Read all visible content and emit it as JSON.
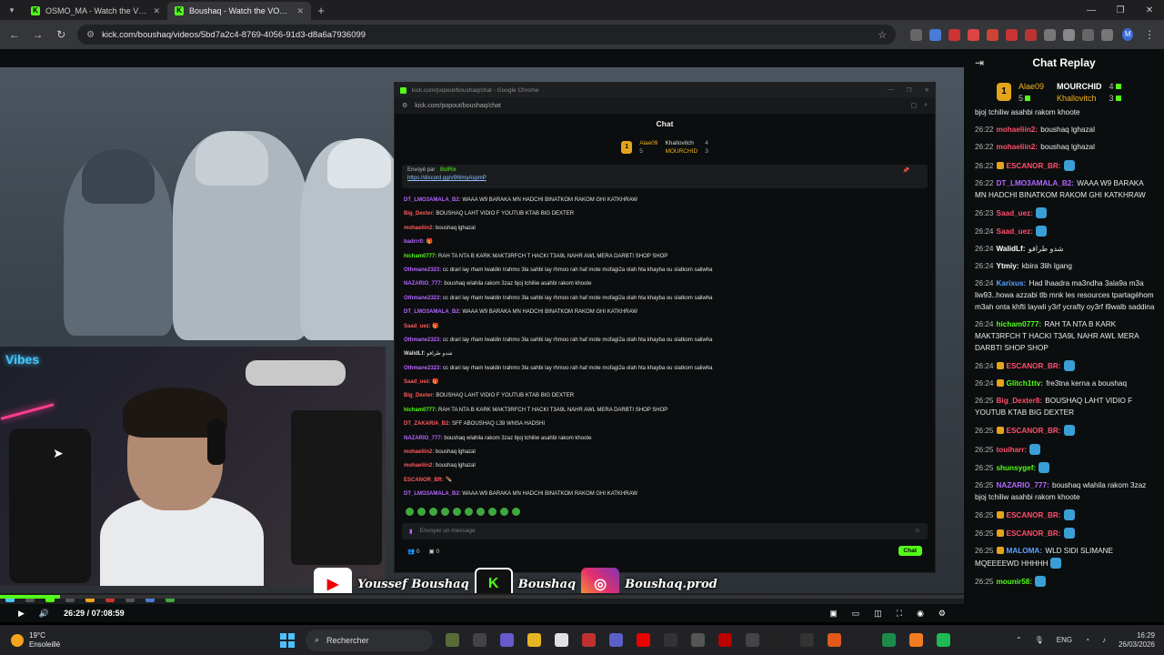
{
  "browser": {
    "tabs": [
      {
        "title": "OSMO_MA - Watch the VOD on",
        "active": false
      },
      {
        "title": "Boushaq - Watch the VOD on",
        "active": true
      }
    ],
    "url": "kick.com/boushaq/videos/5bd7a2c4-8769-4056-91d3-d8a6a7936099",
    "profile_initial": "M"
  },
  "popout": {
    "window_title": "kick.com/popout/boushaq/chat - Google Chrome",
    "url": "kick.com/popout/boushaq/chat",
    "header": "Chat",
    "gifters": {
      "first": "Alae09",
      "first_count": "5",
      "second": "Khallovitch",
      "second_count": "4",
      "third": "MOURCHID",
      "third_count": "3"
    },
    "pinned_sender": "Envoyé par",
    "pinned_sender_name": "BotRix",
    "pinned_link": "https://discord.gg/v9WmyAspmP",
    "messages": [
      {
        "user": "DT_LMO3AMALA_B2:",
        "color": "#b566ff",
        "text": " WAAA W9 BARAKA MN HADCHI BINATKOM RAKOM GHI KATKHRAW"
      },
      {
        "user": "Big_Dexter:",
        "color": "#ff5a5a",
        "text": " BOUSHAQ LAHT VIDIO F YOUTUB KTAB BIG DEXTER"
      },
      {
        "user": "mohaeliin2:",
        "color": "#ff5a5a",
        "text": " boushaq lghazal"
      },
      {
        "user": "badrrr0:",
        "color": "#b566ff",
        "text": " 🎁"
      },
      {
        "user": "hicham0777:",
        "color": "#53fc18",
        "text": " RAH TA NTA B KARK MAKT3RFCH T HACKI T3A9L NAHR AWL MERA DARBTI SHOP SHOP"
      },
      {
        "user": "Othmane2323:",
        "color": "#b566ff",
        "text": " cc drari lay rham lwaldin trahmo 3la sahbi lay rhmoo rah haf mote mofagi2a olah hta khayba ou slatkom saliwha"
      },
      {
        "user": "NAZARIO_777:",
        "color": "#b566ff",
        "text": " boushaq wlahila rakom 3zaz bjoj tchiliw asahbi rakom khoote"
      },
      {
        "user": "Othmane2323:",
        "color": "#b566ff",
        "text": " cc drari lay rham lwaldin trahmo 3la sahbi lay rhmoo rah haf mote mofagi2a olah hta khayba ou slatkom saliwha"
      },
      {
        "user": "DT_LMO3AMALA_B2:",
        "color": "#b566ff",
        "text": " WAAA W9 BARAKA MN HADCHI BINATKOM RAKOM GHI KATKHRAW"
      },
      {
        "user": "Saad_uez:",
        "color": "#ff5a5a",
        "text": " 🎁"
      },
      {
        "user": "Othmane2323:",
        "color": "#b566ff",
        "text": " cc drari lay rham lwaldin trahmo 3la sahbi lay rhmoo rah haf mote mofagi2a olah hta khayba ou slatkom saliwha"
      },
      {
        "user": "WalidLf:",
        "color": "#dddddd",
        "text": " شدو طرافو"
      },
      {
        "user": "Othmane2323:",
        "color": "#b566ff",
        "text": " cc drari lay rham lwaldin trahmo 3la sahbi lay rhmoo rah haf mote mofagi2a olah hta khayba ou slatkom saliwha"
      },
      {
        "user": "Saad_uez:",
        "color": "#ff5a5a",
        "text": " 🎁"
      },
      {
        "user": "Big_Dexter:",
        "color": "#ff5a5a",
        "text": " BOUSHAQ LAHT VIDIO F YOUTUB KTAB BIG DEXTER"
      },
      {
        "user": "hicham0777:",
        "color": "#53fc18",
        "text": " RAH TA NTA B KARK MAKT3RFCH T HACKI T3A9L NAHR AWL MERA DARBTI SHOP SHOP"
      },
      {
        "user": "DT_ZAKARIA_B2:",
        "color": "#ff5a5a",
        "text": " SFF ABOUSHAQ L39 WNSA HADSHI"
      },
      {
        "user": "NAZARIO_777:",
        "color": "#b566ff",
        "text": " boushaq wlahila rakom 3zaz bjoj tchiliw asahbi rakom khoote"
      },
      {
        "user": "mohaeliin2:",
        "color": "#ff5a5a",
        "text": " boushaq lghazal"
      },
      {
        "user": "mohaeliin2:",
        "color": "#ff5a5a",
        "text": " boushaq lghazal"
      },
      {
        "user": "ESCANOR_BR:",
        "color": "#ff5a5a",
        "text": " 🪶"
      },
      {
        "user": "DT_LMO3AMALA_B2:",
        "color": "#b566ff",
        "text": " WAAA W9 BARAKA MN HADCHI BINATKOM RAKOM GHI KATKHRAW"
      }
    ],
    "input_placeholder": "Envoyer un message",
    "bottom_count_a": "0",
    "bottom_count_b": "0",
    "chat_button": "Chat"
  },
  "socials": {
    "youtube": "Youssef Boushaq",
    "kick": "Boushaq",
    "instagram": "Boushaq.prod"
  },
  "player": {
    "time": "26:29 / 07:08:59",
    "progress": 0.062
  },
  "sidebar": {
    "title": "Chat Replay",
    "gifters": {
      "first": "Alae09",
      "first_count": "5",
      "second": "MOURCHID",
      "second_count": "4",
      "third": "Khallovitch",
      "third_count": "3"
    },
    "messages": [
      {
        "time": "",
        "user": "",
        "color": "#eaeaea",
        "text": "bjoj tchiliw asahbi rakom khoote",
        "badge": false,
        "emote": false
      },
      {
        "time": "26:22",
        "user": "mohaeliin2:",
        "color": "#ff4f6d",
        "text": " boushaq lghazal",
        "badge": false,
        "emote": false
      },
      {
        "time": "26:22",
        "user": "mohaeliin2:",
        "color": "#ff4f6d",
        "text": " boushaq lghazal",
        "badge": false,
        "emote": false
      },
      {
        "time": "26:22",
        "user": "ESCANOR_BR:",
        "color": "#ff4f6d",
        "text": "",
        "badge": true,
        "emote": true
      },
      {
        "time": "26:22",
        "user": "DT_LMO3AMALA_B2:",
        "color": "#b566ff",
        "text": " WAAA W9 BARAKA MN HADCHI BINATKOM RAKOM GHI KATKHRAW",
        "badge": false,
        "emote": false
      },
      {
        "time": "26:23",
        "user": "Saad_uez:",
        "color": "#ff4f6d",
        "text": "",
        "badge": false,
        "emote": true
      },
      {
        "time": "26:24",
        "user": "Saad_uez:",
        "color": "#ff4f6d",
        "text": "",
        "badge": false,
        "emote": true
      },
      {
        "time": "26:24",
        "user": "WalidLf:",
        "color": "#ffffff",
        "text": " شدو طرافو",
        "badge": false,
        "emote": false
      },
      {
        "time": "26:24",
        "user": "Ytmiy:",
        "color": "#ffffff",
        "text": " kbira 3lih lgang",
        "badge": false,
        "emote": false
      },
      {
        "time": "26:24",
        "user": "Karixus:",
        "color": "#5aa0ff",
        "text": " Had lhaadra ma3ndha 3ala9a m3a liw93..howa azzabi tlb mnk les resources tpartagèhom m3ah onta khfti laywli y3rf ycrafty oy3rf l9walb saddina",
        "badge": false,
        "emote": false
      },
      {
        "time": "26:24",
        "user": "hicham0777:",
        "color": "#53fc18",
        "text": " RAH TA NTA B KARK MAKT3RFCH T HACKI T3A9L NAHR AWL MERA DARBTI SHOP SHOP",
        "badge": false,
        "emote": false
      },
      {
        "time": "26:24",
        "user": "ESCANOR_BR:",
        "color": "#ff4f6d",
        "text": "",
        "badge": true,
        "emote": true
      },
      {
        "time": "26:24",
        "user": "Glitch1ttv:",
        "color": "#53fc18",
        "text": " fre3tna kerna a boushaq",
        "badge": true,
        "emote": false
      },
      {
        "time": "26:25",
        "user": "Big_Dexter8:",
        "color": "#ff4f6d",
        "text": " BOUSHAQ LAHT VIDIO F YOUTUB KTAB BIG DEXTER",
        "badge": false,
        "emote": false
      },
      {
        "time": "26:25",
        "user": "ESCANOR_BR:",
        "color": "#ff4f6d",
        "text": "",
        "badge": true,
        "emote": true
      },
      {
        "time": "26:25",
        "user": "touiharr:",
        "color": "#ff4f6d",
        "text": "",
        "badge": false,
        "emote": true
      },
      {
        "time": "26:25",
        "user": "shunsygef:",
        "color": "#53fc18",
        "text": "",
        "badge": false,
        "emote": true
      },
      {
        "time": "26:25",
        "user": "NAZARIO_777:",
        "color": "#b566ff",
        "text": " boushaq wlahila rakom 3zaz bjoj tchiliw asahbi rakom khoote",
        "badge": false,
        "emote": false
      },
      {
        "time": "26:25",
        "user": "ESCANOR_BR:",
        "color": "#ff4f6d",
        "text": "",
        "badge": true,
        "emote": true
      },
      {
        "time": "26:25",
        "user": "ESCANOR_BR:",
        "color": "#ff4f6d",
        "text": "",
        "badge": true,
        "emote": true
      },
      {
        "time": "26:25",
        "user": "MALOMA:",
        "color": "#5aa0ff",
        "text": " WLD SIDI SLIMANE MQEEEEWD HHHHH",
        "badge": true,
        "emote": true
      },
      {
        "time": "26:25",
        "user": "mounir58:",
        "color": "#53fc18",
        "text": "",
        "badge": false,
        "emote": true
      }
    ]
  },
  "taskbar": {
    "temp": "19°C",
    "weather": "Ensoleillé",
    "search": "Rechercher",
    "lang": "ENG",
    "time": "16:29",
    "date": "26/03/2026"
  },
  "colors": {
    "kick_green": "#53fc18",
    "gold": "#f2b21b"
  }
}
